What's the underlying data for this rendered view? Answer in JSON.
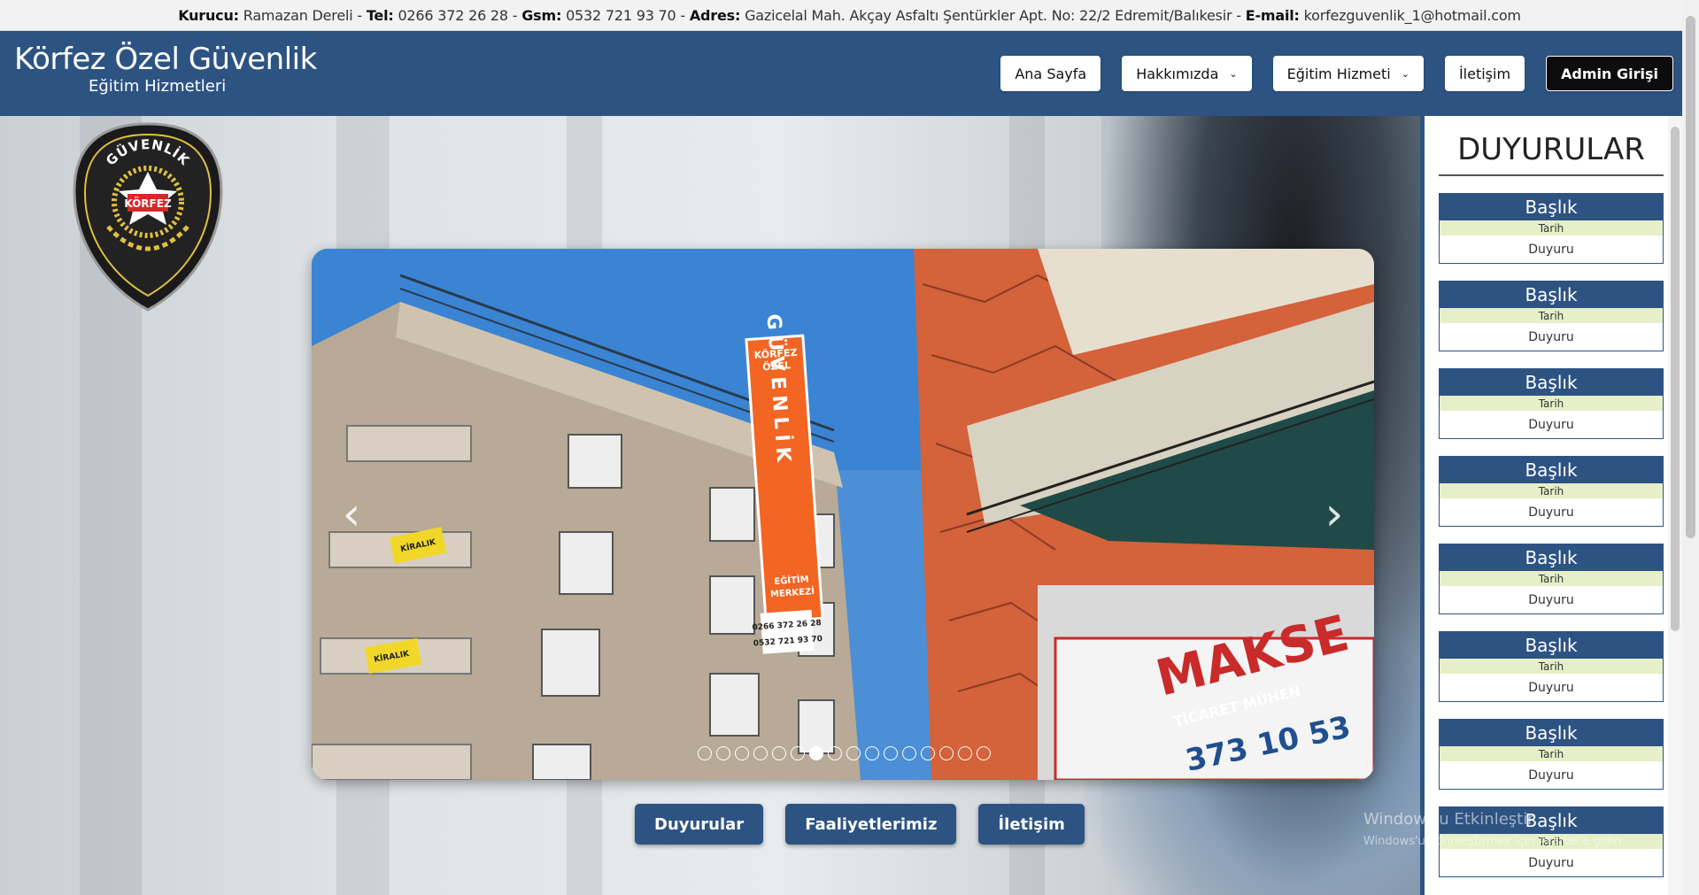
{
  "topbar": {
    "founder_label": "Kurucu:",
    "founder": "Ramazan Dereli",
    "tel_label": "Tel:",
    "tel": "0266 372 26 28",
    "gsm_label": "Gsm:",
    "gsm": "0532 721 93 70",
    "address_label": "Adres:",
    "address": "Gazicelal Mah. Akçay Asfaltı Şentürkler Apt. No: 22/2 Edremit/Balıkesir",
    "email_label": "E-mail:",
    "email": "korfezguvenlik_1@hotmail.com",
    "sep": "-"
  },
  "brand": {
    "title": "Körfez Özel Güvenlik",
    "subtitle": "Eğitim Hizmetleri"
  },
  "nav": {
    "home": "Ana Sayfa",
    "about": "Hakkımızda",
    "training": "Eğitim Hizmeti",
    "contact": "İletişim",
    "admin": "Admin Girişi",
    "dropdown_icon": "chevron-down-icon"
  },
  "logo": {
    "top_text": "GÜVENLİK",
    "center_text": "KÖRFEZ"
  },
  "carousel": {
    "prev_icon": "chevron-left-icon",
    "next_icon": "chevron-right-icon",
    "total_slides": 16,
    "active_slide": 7,
    "sign": {
      "line1": "KÖRFEZ",
      "line2": "ÖZEL",
      "vertical": "GÜVENLİK",
      "line3": "EĞİTİM",
      "line4": "MERKEZİ",
      "phone1": "0266 372 26 28",
      "phone2": "0532 721 93 70"
    },
    "shop_sign": {
      "name": "MAKSE",
      "sub": "TİCARET MÜHEN",
      "phone": "373 10 53"
    },
    "banner": "KİRALIK"
  },
  "bottom_buttons": {
    "announcements": "Duyurular",
    "activities": "Faaliyetlerimiz",
    "contact": "İletişim"
  },
  "announcements": {
    "title": "DUYURULAR",
    "items": [
      {
        "title": "Başlık",
        "date": "Tarih",
        "body": "Duyuru"
      },
      {
        "title": "Başlık",
        "date": "Tarih",
        "body": "Duyuru"
      },
      {
        "title": "Başlık",
        "date": "Tarih",
        "body": "Duyuru"
      },
      {
        "title": "Başlık",
        "date": "Tarih",
        "body": "Duyuru"
      },
      {
        "title": "Başlık",
        "date": "Tarih",
        "body": "Duyuru"
      },
      {
        "title": "Başlık",
        "date": "Tarih",
        "body": "Duyuru"
      },
      {
        "title": "Başlık",
        "date": "Tarih",
        "body": "Duyuru"
      },
      {
        "title": "Başlık",
        "date": "Tarih",
        "body": "Duyuru"
      }
    ]
  },
  "watermark": {
    "line1": "Windows'u Etkinleştir",
    "line2": "Windows'u etkinleştirmek için Ayarlar'a gidin."
  },
  "colors": {
    "brand": "#2d5383",
    "date_strip": "#e6efc7",
    "admin": "#0d0d0d"
  }
}
